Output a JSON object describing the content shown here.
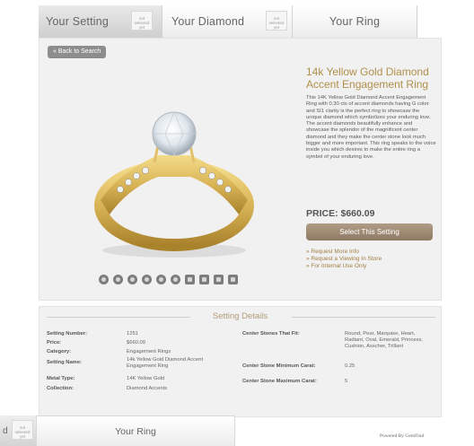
{
  "tabs": [
    {
      "label": "Your Setting",
      "note": "not selected yet"
    },
    {
      "label": "Your Diamond",
      "note": "not selected yet"
    },
    {
      "label": "Your Ring"
    }
  ],
  "product": {
    "back_label": "« Back to Search",
    "title": "14k Yellow Gold Diamond Accent Engagement Ring",
    "description": "This 14K Yellow Gold Diamond Accent Engagement Ring with 0.30 cts of accent diamonds having G color and SI1 clarity is the perfect ring to showcase the unique diamond which symbolizes your enduring love. The accent diamonds beautifully enhance and showcase the splendor of the magnificent center diamond and they make the center stone look much bigger and more important. This ring speaks to the voice inside you which desires to make the entire ring a symbol of your enduring love.",
    "price": "PRICE: $660.09",
    "select_label": "Select This Setting",
    "links": [
      "» Request More Info",
      "» Request a Viewing In Store",
      "» For Internal Use Only"
    ]
  },
  "details": {
    "title": "Setting Details",
    "left": [
      {
        "label": "Setting Number:",
        "value": "1251"
      },
      {
        "label": "Price:",
        "value": "$660.09"
      },
      {
        "label": "Category:",
        "value": "Engagement Rings"
      },
      {
        "label": "Setting Name:",
        "value": "14k Yellow Gold Diamond Accent Engagement Ring"
      },
      {
        "label": "Metal Type:",
        "value": "14K Yellow Gold"
      },
      {
        "label": "Collection:",
        "value": "Diamond Accents"
      }
    ],
    "right": [
      {
        "label": "Center Stones That Fit:",
        "value": "Round, Pear, Marquise, Heart, Radiant, Oval, Emerald, Princess, Cushion, Asscher, Trillant"
      },
      {
        "label": "Center Stone Minimum Carat:",
        "value": "0.25"
      },
      {
        "label": "Center Stone Maximum Carat:",
        "value": "5"
      }
    ]
  },
  "bottom": {
    "partial_tab": "d",
    "note": "not selected yet",
    "ring_tab": "Your Ring"
  },
  "powered_by": "Powered By GemFind",
  "colors": {
    "accent": "#b08f4a",
    "button": "#9c8873",
    "panel": "#f1f1f1"
  }
}
